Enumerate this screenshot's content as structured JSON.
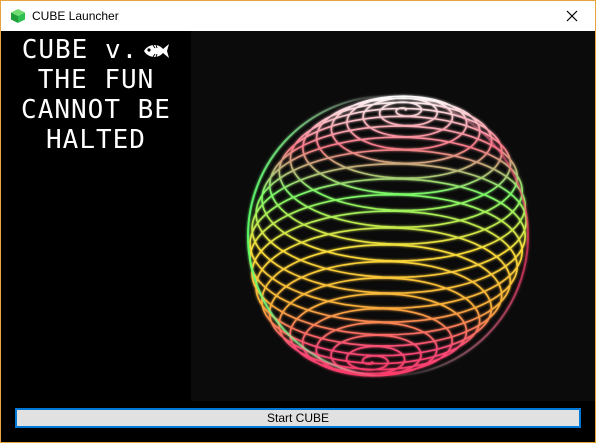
{
  "window": {
    "title": "CUBE Launcher",
    "app_icon": "green-cube-icon",
    "close_icon": "close-icon",
    "border_color": "#e8a33d"
  },
  "side_panel": {
    "headline_lines": [
      "CUBE v.",
      "THE FUN",
      "CANNOT BE",
      "HALTED"
    ],
    "fish_icon": "fish-icon",
    "text_color": "#ffffff",
    "background": "#000000"
  },
  "image": {
    "description_icon": "glowing-spiral-sphere-image",
    "colors": [
      "#ff3b6b",
      "#ffd23a",
      "#5cff6a",
      "#ffffff"
    ]
  },
  "actions": {
    "start_label": "Start CUBE",
    "focus_color": "#0078d7"
  }
}
